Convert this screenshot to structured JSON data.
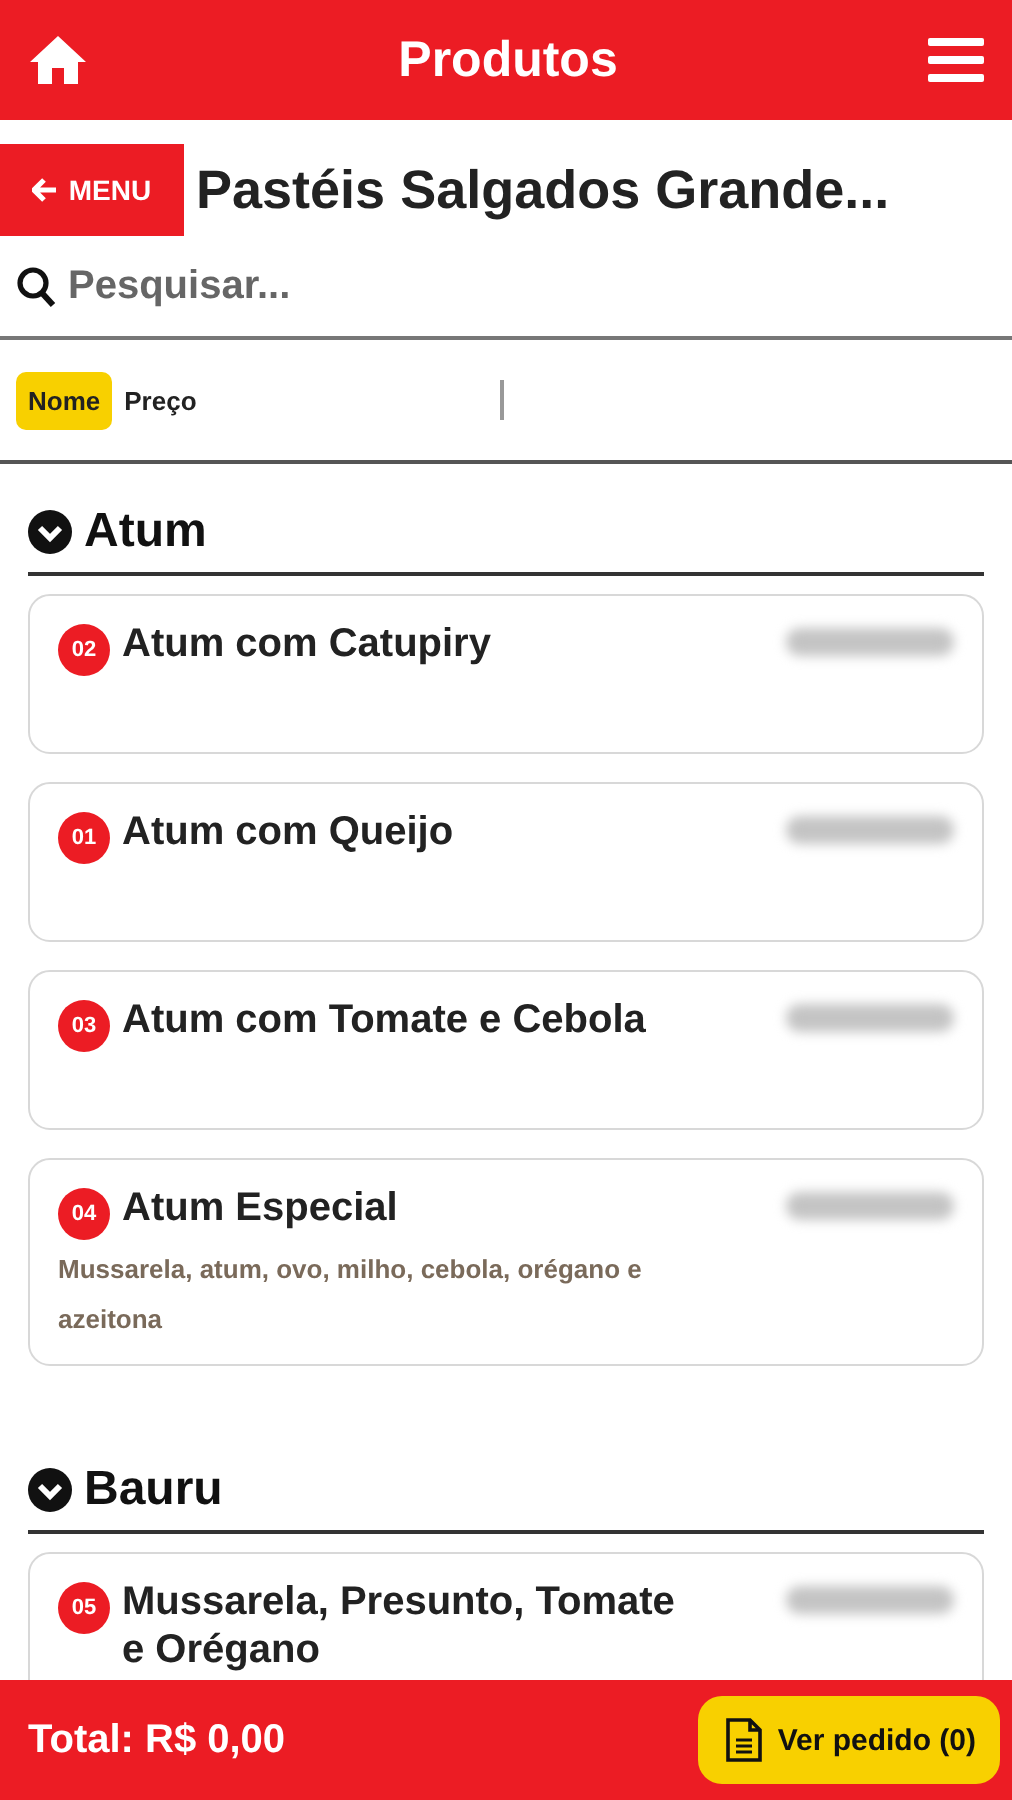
{
  "header": {
    "title": "Produtos"
  },
  "page": {
    "back_button": "MENU",
    "title": "Pastéis Salgados Grande..."
  },
  "search": {
    "placeholder": "Pesquisar..."
  },
  "sort": [
    {
      "label": "Nome",
      "selected": true
    },
    {
      "label": "Preço",
      "selected": false
    }
  ],
  "groups": [
    {
      "name": "Atum",
      "expanded": true,
      "products": [
        {
          "number": "02",
          "name": "Atum com Catupiry"
        },
        {
          "number": "01",
          "name": "Atum com Queijo"
        },
        {
          "number": "03",
          "name": "Atum com Tomate e Cebola"
        },
        {
          "number": "04",
          "name": "Atum Especial",
          "description": "Mussarela, atum, ovo, milho, cebola, orégano e azeitona"
        }
      ]
    },
    {
      "name": "Bauru",
      "expanded": true,
      "products": [
        {
          "number": "05",
          "name": "Mussarela, Presunto, Tomate e Orégano"
        }
      ]
    }
  ],
  "footer": {
    "total": "Total: R$ 0,00",
    "order_button": "Ver pedido (0)"
  }
}
